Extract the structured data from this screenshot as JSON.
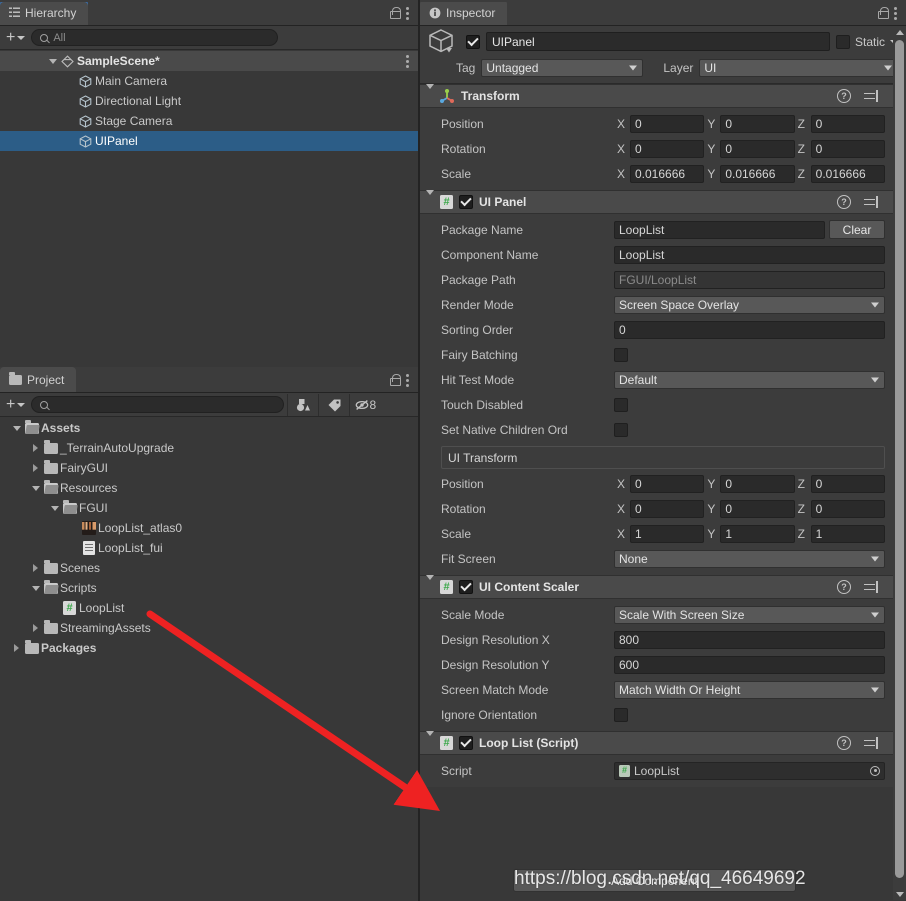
{
  "hierarchy": {
    "tab_label": "Hierarchy",
    "tab_icon": "hierarchy-icon",
    "toolbar": {
      "add_label": "+",
      "search_placeholder": "All",
      "search_value": ""
    },
    "items": [
      {
        "label": "SampleScene*",
        "icon": "unity-scene-icon",
        "depth": 1,
        "expanded": true,
        "selected": false,
        "is_scene": true
      },
      {
        "label": "Main Camera",
        "icon": "gameobject-cube-icon",
        "depth": 2,
        "expanded": null,
        "selected": false,
        "is_scene": false
      },
      {
        "label": "Directional Light",
        "icon": "gameobject-cube-icon",
        "depth": 2,
        "expanded": null,
        "selected": false,
        "is_scene": false
      },
      {
        "label": "Stage Camera",
        "icon": "gameobject-cube-icon",
        "depth": 2,
        "expanded": null,
        "selected": false,
        "is_scene": false
      },
      {
        "label": "UIPanel",
        "icon": "gameobject-cube-icon",
        "depth": 2,
        "expanded": null,
        "selected": true,
        "is_scene": false
      }
    ]
  },
  "project": {
    "tab_label": "Project",
    "toolbar": {
      "add_label": "+",
      "search_placeholder": "",
      "search_value": "",
      "hidden_count": "8"
    },
    "items": [
      {
        "label": "Assets",
        "icon": "folder-open-icon",
        "depth": 0,
        "expanded": true,
        "bold": true
      },
      {
        "label": "_TerrainAutoUpgrade",
        "icon": "folder-icon",
        "depth": 1,
        "expanded": false,
        "bold": false
      },
      {
        "label": "FairyGUI",
        "icon": "folder-icon",
        "depth": 1,
        "expanded": false,
        "bold": false
      },
      {
        "label": "Resources",
        "icon": "folder-open-icon",
        "depth": 1,
        "expanded": true,
        "bold": false
      },
      {
        "label": "FGUI",
        "icon": "folder-open-icon",
        "depth": 2,
        "expanded": true,
        "bold": false
      },
      {
        "label": "LoopList_atlas0",
        "icon": "texture-atlas-icon",
        "depth": 3,
        "expanded": null,
        "bold": false
      },
      {
        "label": "LoopList_fui",
        "icon": "text-asset-icon",
        "depth": 3,
        "expanded": null,
        "bold": false
      },
      {
        "label": "Scenes",
        "icon": "folder-icon",
        "depth": 1,
        "expanded": false,
        "bold": false
      },
      {
        "label": "Scripts",
        "icon": "folder-open-icon",
        "depth": 1,
        "expanded": true,
        "bold": false
      },
      {
        "label": "LoopList",
        "icon": "csharp-script-icon",
        "depth": 2,
        "expanded": null,
        "bold": false
      },
      {
        "label": "StreamingAssets",
        "icon": "folder-icon",
        "depth": 1,
        "expanded": false,
        "bold": false
      },
      {
        "label": "Packages",
        "icon": "folder-icon",
        "depth": 0,
        "expanded": false,
        "bold": true
      }
    ]
  },
  "inspector": {
    "tab_label": "Inspector",
    "object_name": "UIPanel",
    "object_enabled": true,
    "static_label": "Static",
    "static_checked": false,
    "tag_label": "Tag",
    "tag_value": "Untagged",
    "layer_label": "Layer",
    "layer_value": "UI",
    "add_component_label": "Add Component",
    "watermark": "https://blog.csdn.net/qq_46649692",
    "components": [
      {
        "title": "Transform",
        "icon": "transform-axis-icon",
        "has_enable_toggle": false,
        "enabled": true,
        "rows": [
          {
            "type": "vector3",
            "label": "Position",
            "axes": [
              "X",
              "Y",
              "Z"
            ],
            "values": [
              "0",
              "0",
              "0"
            ]
          },
          {
            "type": "vector3",
            "label": "Rotation",
            "axes": [
              "X",
              "Y",
              "Z"
            ],
            "values": [
              "0",
              "0",
              "0"
            ]
          },
          {
            "type": "vector3",
            "label": "Scale",
            "axes": [
              "X",
              "Y",
              "Z"
            ],
            "values": [
              "0.016666",
              "0.016666",
              "0.016666"
            ]
          }
        ]
      },
      {
        "title": "UI Panel",
        "icon": "csharp-script-icon",
        "has_enable_toggle": true,
        "enabled": true,
        "rows": [
          {
            "type": "text_button",
            "label": "Package Name",
            "value": "LoopList",
            "button": "Clear"
          },
          {
            "type": "text",
            "label": "Component Name",
            "value": "LoopList"
          },
          {
            "type": "text_dim",
            "label": "Package Path",
            "value": "FGUI/LoopList"
          },
          {
            "type": "dropdown",
            "label": "Render Mode",
            "value": "Screen Space Overlay"
          },
          {
            "type": "text",
            "label": "Sorting Order",
            "value": "0"
          },
          {
            "type": "checkbox",
            "label": "Fairy Batching",
            "checked": false
          },
          {
            "type": "dropdown",
            "label": "Hit Test Mode",
            "value": "Default"
          },
          {
            "type": "checkbox",
            "label": "Touch Disabled",
            "checked": false
          },
          {
            "type": "checkbox",
            "label": "Set Native Children Ord",
            "checked": false
          },
          {
            "type": "section",
            "label": "UI Transform"
          },
          {
            "type": "vector3",
            "label": "Position",
            "axes": [
              "X",
              "Y",
              "Z"
            ],
            "values": [
              "0",
              "0",
              "0"
            ]
          },
          {
            "type": "vector3",
            "label": "Rotation",
            "axes": [
              "X",
              "Y",
              "Z"
            ],
            "values": [
              "0",
              "0",
              "0"
            ]
          },
          {
            "type": "vector3",
            "label": "Scale",
            "axes": [
              "X",
              "Y",
              "Z"
            ],
            "values": [
              "1",
              "1",
              "1"
            ]
          },
          {
            "type": "dropdown",
            "label": "Fit Screen",
            "value": "None"
          }
        ]
      },
      {
        "title": "UI Content Scaler",
        "icon": "csharp-script-icon",
        "has_enable_toggle": true,
        "enabled": true,
        "rows": [
          {
            "type": "dropdown",
            "label": "Scale Mode",
            "value": "Scale With Screen Size"
          },
          {
            "type": "text",
            "label": "Design Resolution X",
            "value": "800"
          },
          {
            "type": "text",
            "label": "Design Resolution Y",
            "value": "600"
          },
          {
            "type": "dropdown",
            "label": "Screen Match Mode",
            "value": "Match Width Or Height"
          },
          {
            "type": "checkbox",
            "label": "Ignore Orientation",
            "checked": false
          }
        ]
      },
      {
        "title": "Loop List (Script)",
        "icon": "csharp-script-icon",
        "has_enable_toggle": true,
        "enabled": true,
        "rows": [
          {
            "type": "object",
            "label": "Script",
            "value": "LoopList"
          }
        ]
      }
    ]
  },
  "annotation": {
    "arrow_color": "#ee2222",
    "from": "project-looplist-script",
    "to": "loop-list-script-component-header"
  },
  "colors": {
    "selection_blue": "#2c5d87",
    "panel_bg": "#383838",
    "header_bg": "#3c3c3c",
    "component_header": "#4a4a4a",
    "text": "#c4c4c4",
    "accent_tab": "#3a6ea8"
  }
}
